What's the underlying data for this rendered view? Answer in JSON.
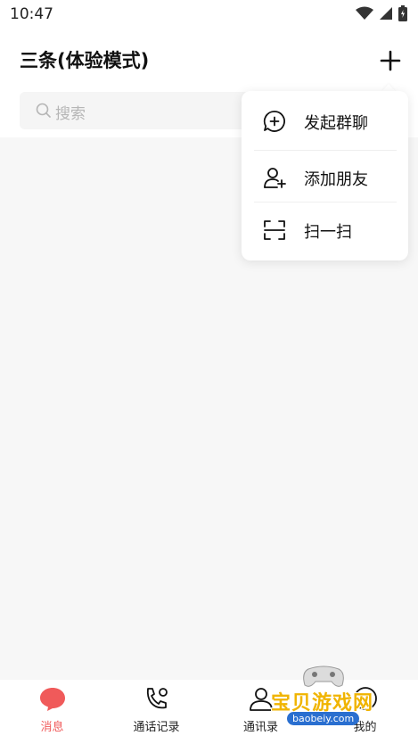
{
  "status_bar": {
    "time": "10:47"
  },
  "header": {
    "title": "三条(体验模式)",
    "search_placeholder": "搜索"
  },
  "popup_menu": {
    "items": [
      {
        "label": "发起群聊",
        "icon": "chat-plus-icon"
      },
      {
        "label": "添加朋友",
        "icon": "add-user-icon"
      },
      {
        "label": "扫一扫",
        "icon": "scan-icon"
      }
    ]
  },
  "tabbar": {
    "tabs": [
      {
        "label": "消息",
        "icon": "message-icon",
        "active": true
      },
      {
        "label": "通话记录",
        "icon": "call-log-icon",
        "active": false
      },
      {
        "label": "通讯录",
        "icon": "contacts-icon",
        "active": false
      },
      {
        "label": "我的",
        "icon": "profile-icon",
        "active": false
      }
    ]
  },
  "watermark": {
    "brand": "宝贝游戏网",
    "url": "baobeiy.com"
  },
  "colors": {
    "accent": "#f05a5a",
    "background": "#f7f7f7"
  }
}
